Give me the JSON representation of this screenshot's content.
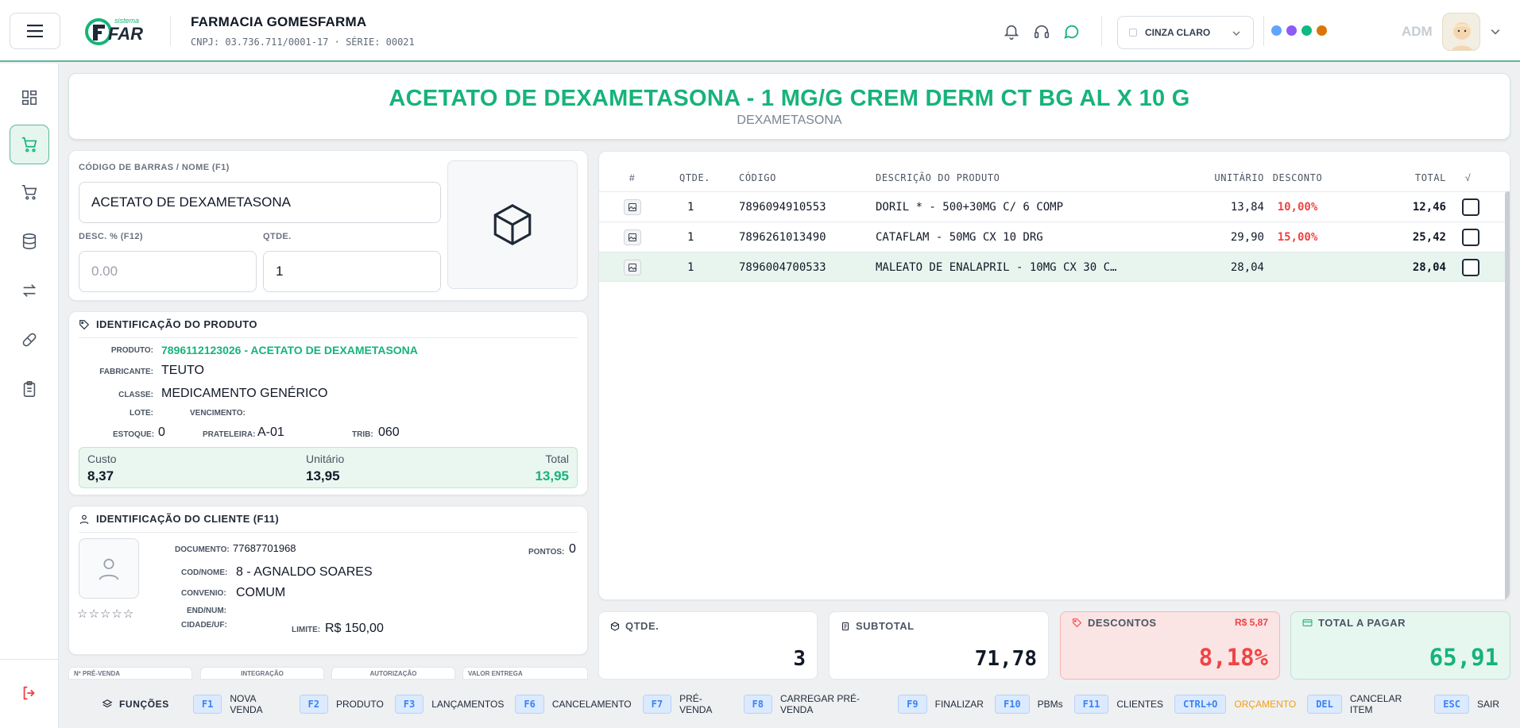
{
  "header": {
    "logo_small": "sistema",
    "logo_main": "FAR",
    "company_name": "FARMACIA GOMESFARMA",
    "company_info": "CNPJ: 03.736.711/0001-17 · SÉRIE: 00021",
    "theme_selected": "CINZA CLARO",
    "theme_dot_colors": [
      "#60a5fa",
      "#8b5cf6",
      "#10b981",
      "#d97706"
    ],
    "user": "ADM"
  },
  "sidebar": {
    "items": [
      "dashboard-icon",
      "cart-icon",
      "cart-outline-icon",
      "database-icon",
      "transfer-icon",
      "pill-icon",
      "clipboard-icon"
    ],
    "active": "cart-icon",
    "logout": "logout-icon"
  },
  "product_title": {
    "name": "ACETATO DE DEXAMETASONA - 1 MG/G CREM DERM CT BG AL X 10 G",
    "substance": "DEXAMETASONA"
  },
  "entry": {
    "barcode_label": "CÓDIGO DE BARRAS / NOME (F1)",
    "barcode_value": "ACETATO DE DEXAMETASONA",
    "desc_label": "DESC. % (F12)",
    "desc_placeholder": "0.00",
    "qty_label": "QTDE.",
    "qty_value": "1"
  },
  "product_info": {
    "title": "IDENTIFICAÇÃO DO PRODUTO",
    "produto_label": "PRODUTO:",
    "produto_value": "7896112123026 - ACETATO DE DEXAMETASONA",
    "fabricante_label": "FABRICANTE:",
    "fabricante_value": "TEUTO",
    "classe_label": "CLASSE:",
    "classe_value": "MEDICAMENTO GENÉRICO",
    "lote_label": "LOTE:",
    "vencimento_label": "VENCIMENTO:",
    "estoque_label": "ESTOQUE:",
    "estoque_value": "0",
    "prateleira_label": "PRATELEIRA:",
    "prateleira_value": "A-01",
    "trib_label": "TRIB:",
    "trib_value": "060",
    "custo_label": "Custo",
    "custo_value": "8,37",
    "unitario_label": "Unitário",
    "unitario_value": "13,95",
    "total_label": "Total",
    "total_value": "13,95"
  },
  "client_info": {
    "title": "IDENTIFICAÇÃO DO CLIENTE (F11)",
    "documento_label": "DOCUMENTO:",
    "documento_value": "77687701968",
    "pontos_label": "PONTOS:",
    "pontos_value": "0",
    "codnome_label": "COD/NOME:",
    "codnome_value": "8 - AGNALDO SOARES",
    "convenio_label": "CONVENIO:",
    "convenio_value": "COMUM",
    "endnum_label": "END/NUM:",
    "cidade_label": "CIDADE/UF:",
    "limite_label": "LIMITE:",
    "limite_value": "R$ 150,00",
    "stars": "☆☆☆☆☆"
  },
  "bottom_tabs": [
    "Nº PRÉ-VENDA",
    "INTEGRAÇÃO",
    "AUTORIZAÇÃO",
    "VALOR ENTREGA"
  ],
  "table": {
    "headers": {
      "num": "#",
      "qtde": "QTDE.",
      "codigo": "CÓDIGO",
      "descricao": "DESCRIÇÃO DO PRODUTO",
      "unitario": "UNITÁRIO",
      "desconto": "DESCONTO",
      "total": "TOTAL",
      "check": "√"
    },
    "rows": [
      {
        "qtde": "1",
        "codigo": "7896094910553",
        "descricao": "DORIL * - 500+30MG C/ 6 COMP",
        "unitario": "13,84",
        "desconto": "10,00%",
        "total": "12,46"
      },
      {
        "qtde": "1",
        "codigo": "7896261013490",
        "descricao": "CATAFLAM - 50MG CX 10 DRG",
        "unitario": "29,90",
        "desconto": "15,00%",
        "total": "25,42"
      },
      {
        "qtde": "1",
        "codigo": "7896004700533",
        "descricao": "MALEATO DE ENALAPRIL - 10MG CX 30 C…",
        "unitario": "28,04",
        "desconto": "",
        "total": "28,04"
      }
    ]
  },
  "summary": {
    "qtde_label": "QTDE.",
    "qtde_value": "3",
    "subtotal_label": "SUBTOTAL",
    "subtotal_value": "71,78",
    "descontos_label": "DESCONTOS",
    "descontos_amount": "R$ 5,87",
    "descontos_value": "8,18%",
    "total_label": "TOTAL A PAGAR",
    "total_value": "65,91"
  },
  "function_bar": {
    "title": "FUNÇÕES",
    "keys": [
      {
        "key": "F1",
        "label": "NOVA VENDA"
      },
      {
        "key": "F2",
        "label": "PRODUTO"
      },
      {
        "key": "F3",
        "label": "LANÇAMENTOS"
      },
      {
        "key": "F6",
        "label": "CANCELAMENTO"
      },
      {
        "key": "F7",
        "label": "PRÉ-VENDA"
      },
      {
        "key": "F8",
        "label": "CARREGAR PRÉ-VENDA"
      },
      {
        "key": "F9",
        "label": "FINALIZAR"
      },
      {
        "key": "F10",
        "label": "PBMs"
      },
      {
        "key": "F11",
        "label": "CLIENTES"
      },
      {
        "key": "CTRL+O",
        "label": "ORÇAMENTO"
      },
      {
        "key": "DEL",
        "label": "CANCELAR ITEM"
      },
      {
        "key": "ESC",
        "label": "SAIR"
      }
    ]
  },
  "colors": {
    "accent": "#16b37a",
    "danger": "#ef4444",
    "highlight": "#f59e0b"
  }
}
